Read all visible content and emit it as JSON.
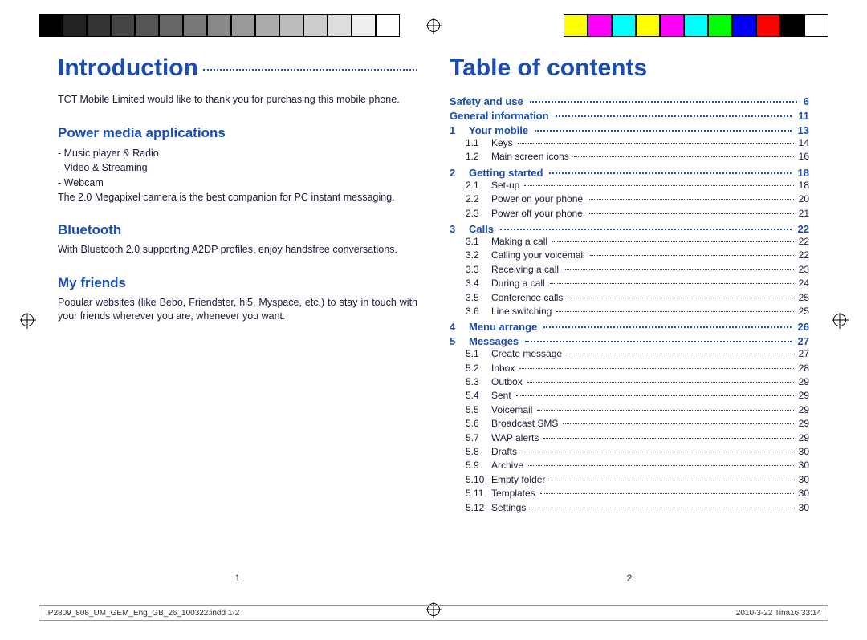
{
  "left": {
    "title": "Introduction",
    "intro_text": "TCT Mobile Limited would like to thank you for purchasing this mobile phone.",
    "h2_power": "Power media applications",
    "power_items": [
      "Music player & Radio",
      "Video & Streaming",
      "Webcam"
    ],
    "power_note": "The 2.0 Megapixel camera is the best companion for PC instant messaging.",
    "h2_bluetooth": "Bluetooth",
    "bluetooth_text": "With Bluetooth 2.0 supporting A2DP profiles, enjoy handsfree conversations.",
    "h2_friends": "My friends",
    "friends_text": "Popular websites (like Bebo, Friendster, hi5, Myspace, etc.) to stay in touch with your friends wherever you are, whenever you want.",
    "page_num": "1"
  },
  "right": {
    "title": "Table of contents",
    "toc_top": [
      {
        "num": "",
        "label": "Safety and use",
        "page": "6"
      },
      {
        "num": "",
        "label": "General information",
        "page": "11"
      },
      {
        "num": "1",
        "label": "Your mobile",
        "page": "13",
        "subs": [
          {
            "n": "1.1",
            "l": "Keys",
            "p": "14"
          },
          {
            "n": "1.2",
            "l": "Main screen icons",
            "p": "16"
          }
        ]
      },
      {
        "num": "2",
        "label": "Getting started",
        "page": "18",
        "subs": [
          {
            "n": "2.1",
            "l": "Set-up",
            "p": "18"
          },
          {
            "n": "2.2",
            "l": "Power on your phone",
            "p": "20"
          },
          {
            "n": "2.3",
            "l": "Power off your phone",
            "p": "21"
          }
        ]
      },
      {
        "num": "3",
        "label": "Calls",
        "page": "22",
        "subs": [
          {
            "n": "3.1",
            "l": "Making a call",
            "p": "22"
          },
          {
            "n": "3.2",
            "l": "Calling your voicemail",
            "p": "22"
          },
          {
            "n": "3.3",
            "l": "Receiving a call",
            "p": "23"
          },
          {
            "n": "3.4",
            "l": "During a call",
            "p": "24"
          },
          {
            "n": "3.5",
            "l": "Conference calls",
            "p": "25"
          },
          {
            "n": "3.6",
            "l": "Line switching",
            "p": "25"
          }
        ]
      },
      {
        "num": "4",
        "label": "Menu arrange",
        "page": "26"
      },
      {
        "num": "5",
        "label": "Messages",
        "page": "27",
        "subs": [
          {
            "n": "5.1",
            "l": "Create message",
            "p": "27"
          },
          {
            "n": "5.2",
            "l": "Inbox",
            "p": "28"
          },
          {
            "n": "5.3",
            "l": "Outbox",
            "p": "29"
          },
          {
            "n": "5.4",
            "l": "Sent",
            "p": "29"
          },
          {
            "n": "5.5",
            "l": "Voicemail",
            "p": "29"
          },
          {
            "n": "5.6",
            "l": "Broadcast SMS",
            "p": "29"
          },
          {
            "n": "5.7",
            "l": "WAP alerts",
            "p": "29"
          },
          {
            "n": "5.8",
            "l": "Drafts",
            "p": "30"
          },
          {
            "n": "5.9",
            "l": "Archive",
            "p": "30"
          },
          {
            "n": "5.10",
            "l": "Empty folder",
            "p": "30"
          },
          {
            "n": "5.11",
            "l": "Templates",
            "p": "30"
          },
          {
            "n": "5.12",
            "l": "Settings",
            "p": "30"
          }
        ]
      }
    ],
    "page_num": "2"
  },
  "footer": {
    "left": "IP2809_808_UM_GEM_Eng_GB_26_100322.indd   1-2",
    "right": "2010-3-22   Tina16:33:14"
  },
  "color_bars_left": [
    "#000",
    "#222",
    "#333",
    "#444",
    "#555",
    "#666",
    "#777",
    "#888",
    "#999",
    "#aaa",
    "#bbb",
    "#ccc",
    "#ddd",
    "#eee",
    "#fff"
  ],
  "color_bars_right": [
    "#ffff00",
    "#ff00ff",
    "#00ffff",
    "#ffff00",
    "#ff00ff",
    "#00ffff",
    "#00ff00",
    "#0000ff",
    "#ff0000",
    "#000",
    "#fff"
  ]
}
